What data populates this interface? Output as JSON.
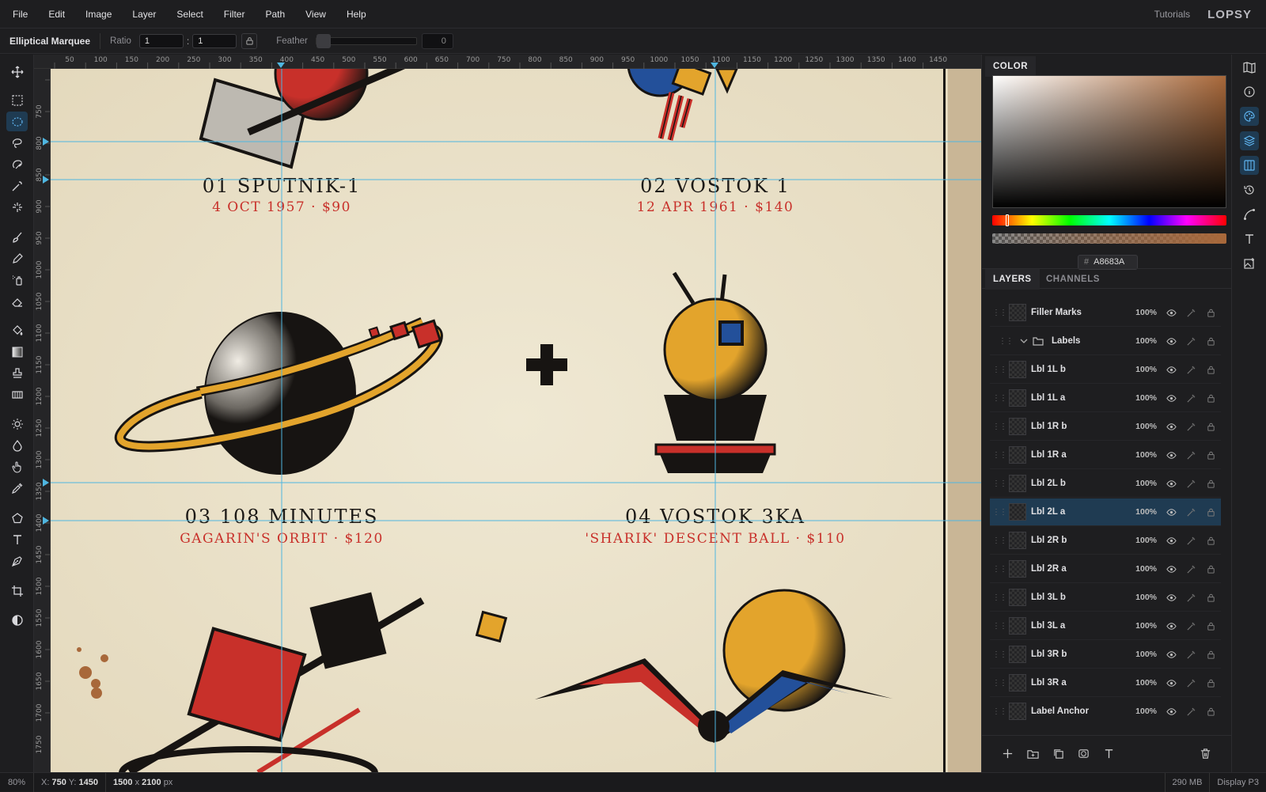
{
  "menubar": {
    "items": [
      "File",
      "Edit",
      "Image",
      "Layer",
      "Select",
      "Filter",
      "Path",
      "View",
      "Help"
    ],
    "tutorials": "Tutorials",
    "brand": "LOPSY"
  },
  "options": {
    "tool_name": "Elliptical Marquee",
    "ratio_label": "Ratio",
    "ratio_w": "1",
    "ratio_sep": ":",
    "ratio_h": "1",
    "feather_label": "Feather",
    "feather_value": "0"
  },
  "ruler": {
    "top_ticks": [
      "50",
      "100",
      "150",
      "200",
      "250",
      "300",
      "350",
      "400",
      "450",
      "500",
      "550",
      "600",
      "650",
      "700",
      "750",
      "800",
      "850",
      "900",
      "950",
      "1000",
      "1050",
      "1100",
      "1150",
      "1200",
      "1250",
      "1300",
      "1350",
      "1400",
      "1450"
    ],
    "left_ticks": [
      "750",
      "800",
      "850",
      "900",
      "950",
      "1000",
      "1050",
      "1100",
      "1150",
      "1200",
      "1250",
      "1300",
      "1350",
      "1400",
      "1450",
      "1500",
      "1550",
      "1600",
      "1650",
      "1700",
      "1750"
    ]
  },
  "artboard": {
    "labels": [
      {
        "title": "01  SPUTNIK-1",
        "sub": "4 OCT 1957  ·  $90"
      },
      {
        "title": "02  VOSTOK 1",
        "sub": "12 APR 1961  ·  $140"
      },
      {
        "title": "03  108 MINUTES",
        "sub": "GAGARIN'S ORBIT  ·  $120"
      },
      {
        "title": "04  VOSTOK 3KA",
        "sub": "'SHARIK' DESCENT BALL  ·  $110"
      }
    ],
    "colors": {
      "paper": "#ebe3cc",
      "red": "#c8302a",
      "gold": "#e3a42c",
      "black": "#171412",
      "blue": "#23509a",
      "grey": "#bdb9b1",
      "guide": "#4fb6e0"
    }
  },
  "color_panel": {
    "tab": "COLOR",
    "hex_prefix": "#",
    "hex": "A8683A",
    "current": "#a8683a"
  },
  "layers_panel": {
    "tabs": [
      "LAYERS",
      "CHANNELS"
    ],
    "rows": [
      {
        "name": "Filler Marks",
        "opacity": "100%"
      },
      {
        "name": "Labels",
        "opacity": "100%",
        "group": true
      },
      {
        "name": "Lbl 1L b",
        "opacity": "100%"
      },
      {
        "name": "Lbl 1L a",
        "opacity": "100%"
      },
      {
        "name": "Lbl 1R b",
        "opacity": "100%"
      },
      {
        "name": "Lbl 1R a",
        "opacity": "100%"
      },
      {
        "name": "Lbl 2L b",
        "opacity": "100%"
      },
      {
        "name": "Lbl 2L a",
        "opacity": "100%",
        "selected": true
      },
      {
        "name": "Lbl 2R b",
        "opacity": "100%"
      },
      {
        "name": "Lbl 2R a",
        "opacity": "100%"
      },
      {
        "name": "Lbl 3L b",
        "opacity": "100%"
      },
      {
        "name": "Lbl 3L a",
        "opacity": "100%"
      },
      {
        "name": "Lbl 3R b",
        "opacity": "100%"
      },
      {
        "name": "Lbl 3R a",
        "opacity": "100%"
      },
      {
        "name": "Label Anchor",
        "opacity": "100%"
      }
    ]
  },
  "status": {
    "zoom": "80%",
    "coords_label_x": "X:",
    "x": "750",
    "coords_label_y": "Y:",
    "y": "1450",
    "doc_w": "1500",
    "doc_x": "x",
    "doc_h": "2100",
    "doc_unit": "px",
    "memory": "290 MB",
    "profile": "Display P3"
  }
}
